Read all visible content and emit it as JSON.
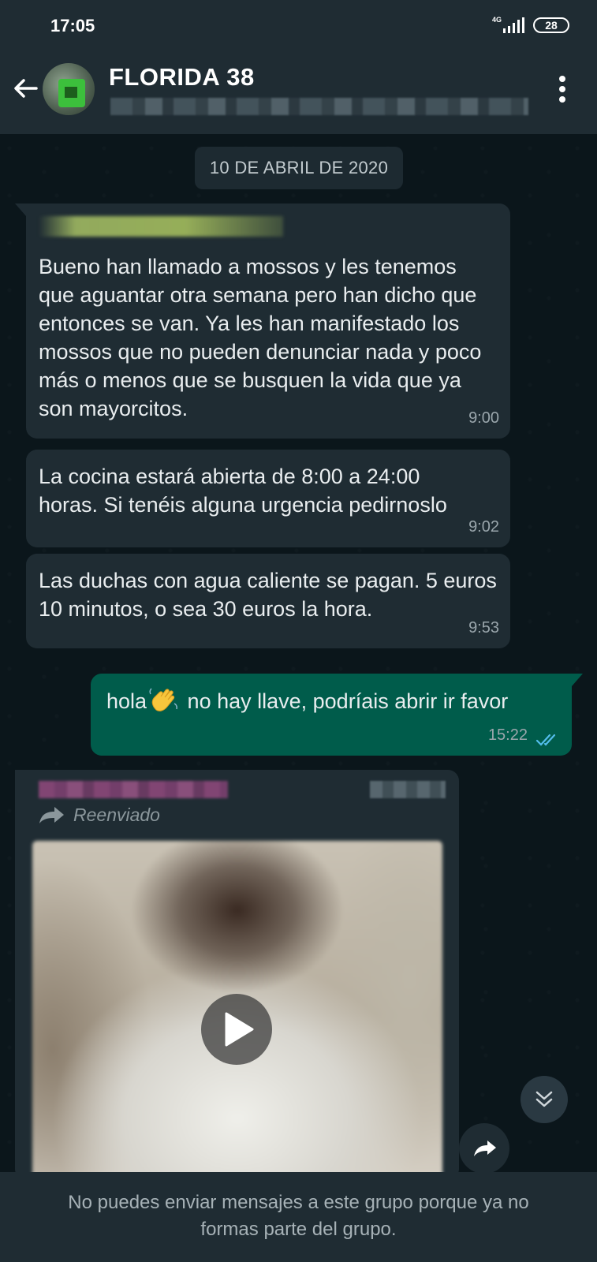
{
  "status_bar": {
    "time": "17:05",
    "network": "4G",
    "battery": "28"
  },
  "header": {
    "title": "FLORIDA 38",
    "back_icon": "arrow-left-icon",
    "menu_icon": "more-vert-icon"
  },
  "chat": {
    "date_chip": "10 DE ABRIL DE 2020",
    "messages": [
      {
        "text": "Bueno han llamado a mossos y les tenemos que aguantar otra semana pero han dicho que entonces se van. Ya les han manifestado los mossos que no pueden denunciar nada y poco más o menos que se busquen la vida que ya son mayorcitos.",
        "time": "9:00"
      },
      {
        "text": "La cocina estará abierta de 8:00 a 24:00 horas. Si tenéis alguna urgencia pedirnoslo",
        "time": "9:02"
      },
      {
        "text": "Las duchas con agua caliente se pagan. 5 euros 10 minutos, o sea 30 euros la hora.",
        "time": "9:53"
      }
    ],
    "outgoing": {
      "text_before": "hola",
      "emoji": "waving-hand-icon",
      "text_after": " no hay llave, podríais abrir ir favor",
      "time": "15:22",
      "status_icon": "double-check-icon"
    },
    "forwarded": {
      "label": "Reenviado",
      "media": "video",
      "play_icon": "play-icon",
      "share_icon": "share-arrow-icon"
    },
    "scroll_down_icon": "chevrons-down-icon"
  },
  "footer": {
    "notice": "No puedes enviar mensajes a este grupo porque ya no formas parte del grupo."
  },
  "colors": {
    "header_bg": "#1f2c33",
    "chat_bg": "#0b161b",
    "incoming_bubble": "#1f2c33",
    "outgoing_bubble": "#005c4b",
    "read_check": "#53bdeb"
  }
}
